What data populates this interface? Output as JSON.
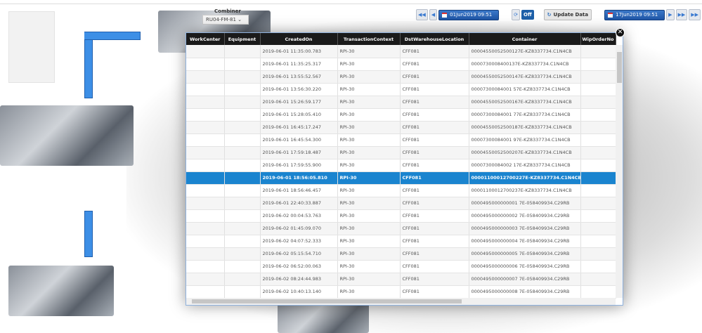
{
  "combiner": {
    "label": "Combiner",
    "value": "RU04-FM-81"
  },
  "toolbar": {
    "start_date": "01Jun2019 09:51",
    "auto_refresh": "Off",
    "update_label": "Update Data",
    "end_date": "17Jun2019 09:51"
  },
  "table": {
    "columns": [
      "WorkCenter",
      "Equipment",
      "CreatedOn",
      "TransactionContext",
      "DstWarehouseLocation",
      "Container",
      "WipOrderNo"
    ],
    "selected_index": 10,
    "rows": [
      [
        "",
        "",
        "2019-06-01 11:35:00.783",
        "RPI-30",
        "CFF081",
        "00004550052500127E-KZ8337734.C1N4CB",
        ""
      ],
      [
        "",
        "",
        "2019-06-01 11:35:25.317",
        "RPI-30",
        "CFF081",
        "0000730008400137E-KZ8337734.C1N4CB",
        ""
      ],
      [
        "",
        "",
        "2019-06-01 13:55:52.567",
        "RPI-30",
        "CFF081",
        "00004550052500147E-KZ8337734.C1N4CB",
        ""
      ],
      [
        "",
        "",
        "2019-06-01 13:56:30.220",
        "RPI-30",
        "CFF081",
        "00007300084001 57E-KZ8337734.C1N4CB",
        ""
      ],
      [
        "",
        "",
        "2019-06-01 15:26:59.177",
        "RPI-30",
        "CFF081",
        "00004550052500167E-KZ8337734.C1N4CB",
        ""
      ],
      [
        "",
        "",
        "2019-06-01 15:28:05.410",
        "RPI-30",
        "CFF081",
        "00007300084001 77E-KZ8337734.C1N4CB",
        ""
      ],
      [
        "",
        "",
        "2019-06-01 16:45:17.247",
        "RPI-30",
        "CFF081",
        "00004550052500187E-KZ8337734.C1N4CB",
        ""
      ],
      [
        "",
        "",
        "2019-06-01 16:45:54.300",
        "RPI-30",
        "CFF081",
        "00007300084001 97E-KZ8337734.C1N4CB",
        ""
      ],
      [
        "",
        "",
        "2019-06-01 17:59:18.487",
        "RPI-30",
        "CFF081",
        "00004550052500207E-KZ8337734.C1N4CB",
        ""
      ],
      [
        "",
        "",
        "2019-06-01 17:59:55.900",
        "RPI-30",
        "CFF081",
        "00007300084002 17E-KZ8337734.C1N4CB",
        ""
      ],
      [
        "",
        "",
        "2019-06-01 18:56:05.810",
        "RPI-30",
        "CFF081",
        "00001100012700227E-KZ8337734.C1N4CB",
        ""
      ],
      [
        "",
        "",
        "2019-06-01 18:56:46.457",
        "RPI-30",
        "CFF081",
        "00001100012700237E-KZ8337734.C1N4CB",
        ""
      ],
      [
        "",
        "",
        "2019-06-01 22:40:33.887",
        "RPI-30",
        "CFF081",
        "0000495000000001 7E-058409934.C29RB",
        ""
      ],
      [
        "",
        "",
        "2019-06-02 00:04:53.763",
        "RPI-30",
        "CFF081",
        "0000495000000002 7E-058409934.C29RB",
        ""
      ],
      [
        "",
        "",
        "2019-06-02 01:45:09.070",
        "RPI-30",
        "CFF081",
        "0000495000000003 7E-058409934.C29RB",
        ""
      ],
      [
        "",
        "",
        "2019-06-02 04:07:52.333",
        "RPI-30",
        "CFF081",
        "0000495000000004 7E-058409934.C29RB",
        ""
      ],
      [
        "",
        "",
        "2019-06-02 05:15:54.710",
        "RPI-30",
        "CFF081",
        "0000495000000005 7E-058409934.C29RB",
        ""
      ],
      [
        "",
        "",
        "2019-06-02 06:52:00.063",
        "RPI-30",
        "CFF081",
        "0000495000000006 7E-058409934.C29RB",
        ""
      ],
      [
        "",
        "",
        "2019-06-02 08:24:44.983",
        "RPI-30",
        "CFF081",
        "0000495000000007 7E-058409934.C29RB",
        ""
      ],
      [
        "",
        "",
        "2019-06-02 10:40:13.140",
        "RPI-30",
        "CFF081",
        "0000495000000008 7E-058409934.C29RB",
        ""
      ]
    ]
  },
  "colors": {
    "accent": "#1a84cf",
    "header": "#1a1a1a",
    "arrow": "#3d8fe6"
  }
}
